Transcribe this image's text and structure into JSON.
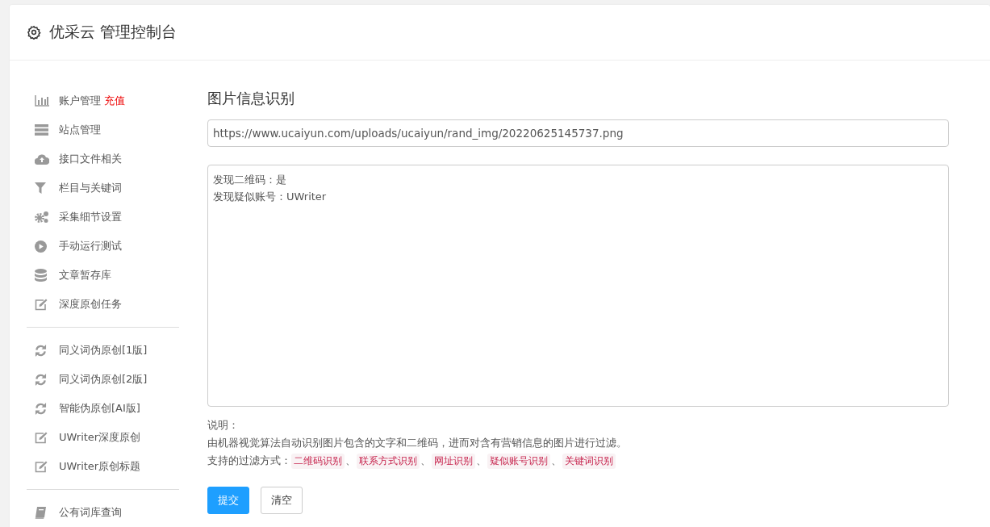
{
  "header": {
    "title": "优采云 管理控制台"
  },
  "sidebar": {
    "groups": [
      {
        "items": [
          {
            "label": "账户管理",
            "badge": "充值"
          },
          {
            "label": "站点管理"
          },
          {
            "label": "接口文件相关"
          },
          {
            "label": "栏目与关键词"
          },
          {
            "label": "采集细节设置"
          },
          {
            "label": "手动运行测试"
          },
          {
            "label": "文章暂存库"
          },
          {
            "label": "深度原创任务"
          }
        ]
      },
      {
        "items": [
          {
            "label": "同义词伪原创[1版]"
          },
          {
            "label": "同义词伪原创[2版]"
          },
          {
            "label": "智能伪原创[AI版]"
          },
          {
            "label": "UWriter深度原创"
          },
          {
            "label": "UWriter原创标题"
          }
        ]
      },
      {
        "items": [
          {
            "label": "公有词库查询"
          }
        ]
      }
    ]
  },
  "main": {
    "title": "图片信息识别",
    "url_field": {
      "value": "https://www.ucaiyun.com/uploads/ucaiyun/rand_img/20220625145737.png"
    },
    "result_box": {
      "lines": [
        "发现二维码：是",
        "发现疑似账号：UWriter"
      ]
    },
    "notes": {
      "heading": "说明：",
      "description": "由机器视觉算法自动识别图片包含的文字和二维码，进而对含有营销信息的图片进行过滤。",
      "methods_label": "支持的过滤方式：",
      "methods": [
        "二维码识别",
        "联系方式识别",
        "网址识别",
        "疑似账号识别",
        "关键词识别"
      ],
      "separator": "、"
    },
    "buttons": [
      {
        "label": "提交",
        "kind": "primary"
      },
      {
        "label": "清空",
        "kind": "default"
      }
    ]
  }
}
